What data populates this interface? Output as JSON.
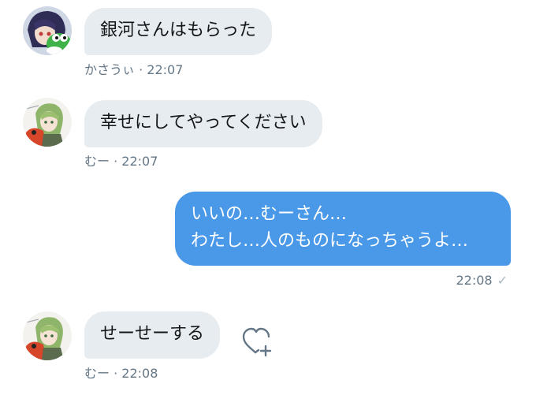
{
  "messages": [
    {
      "text": "銀河さんはもらった",
      "sender": "かさうぃ",
      "time": "22:07",
      "avatar_icon": "character-avatar-with-green-creature"
    },
    {
      "text": "幸せにしてやってください",
      "sender": "むー",
      "time": "22:07",
      "avatar_icon": "character-avatar-green-hair"
    },
    {
      "line1": "いいの…むーさん…",
      "line2": "わたし…人のものになっちゃうよ…",
      "time": "22:08",
      "read_icon": "checkmark-icon"
    },
    {
      "text": "せーせーする",
      "sender": "むー",
      "time": "22:08",
      "avatar_icon": "character-avatar-green-hair",
      "action_icon": "heart-plus-icon"
    }
  ],
  "meta_separator": " · ",
  "colors": {
    "incoming_bubble": "#e6ecf0",
    "outgoing_bubble": "#4a99e9",
    "meta_text": "#657786"
  }
}
